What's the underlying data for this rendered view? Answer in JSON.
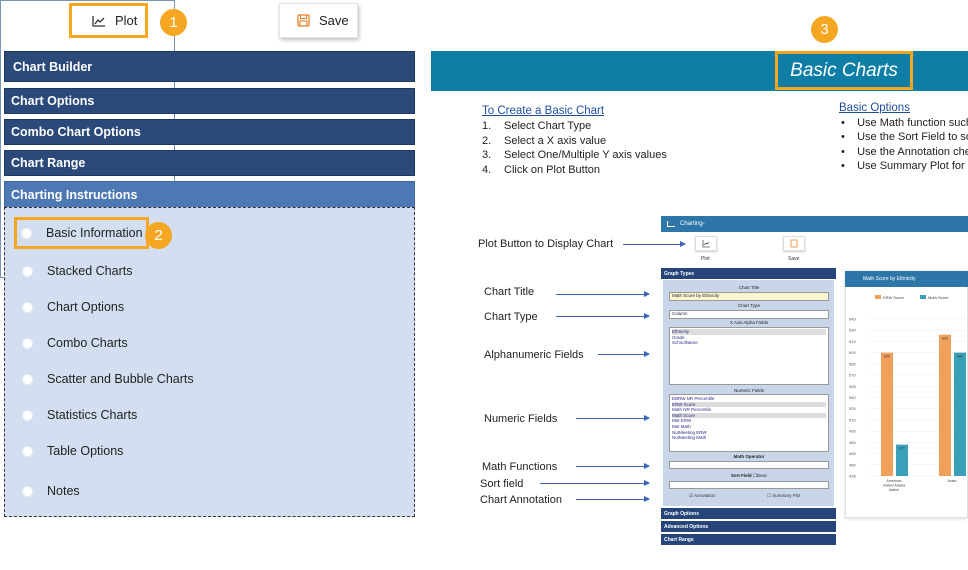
{
  "toolbar": {
    "plot_label": "Plot",
    "save_label": "Save",
    "plot_icon": "line-chart-icon",
    "save_icon": "floppy-disk-icon"
  },
  "callouts": [
    "1",
    "2",
    "3"
  ],
  "accordion": {
    "chart_builder": "Chart Builder",
    "chart_options": "Chart Options",
    "combo_chart_options": "Combo Chart Options",
    "chart_range": "Chart Range",
    "charting_instructions": "Charting Instructions",
    "items": [
      "Basic Information",
      "Stacked Charts",
      "Chart Options",
      "Combo Charts",
      "Scatter and Bubble Charts",
      "Statistics Charts",
      "Table Options",
      "Notes"
    ]
  },
  "right": {
    "banner_title": "Basic Charts",
    "create_title": "To Create a Basic Chart",
    "create_steps": [
      [
        "1.",
        "Select Chart Type"
      ],
      [
        "2.",
        "Select a X axis value"
      ],
      [
        "3.",
        "Select One/Multiple Y axis values"
      ],
      [
        "4.",
        "Click on Plot Button"
      ]
    ],
    "options_title": "Basic Options",
    "options_lines": [
      "Use Math function such",
      "Use the Sort Field to so",
      "Use the Annotation che",
      "Use Summary Plot for a"
    ],
    "annotations": {
      "plot_button": "Plot Button to Display Chart",
      "chart_title": "Chart Title",
      "chart_type": "Chart Type",
      "alphanumeric": "Alphanumeric Fields",
      "numeric": "Numeric Fields",
      "math_functions": "Math Functions",
      "sort_field": "Sort field",
      "chart_annotation": "Chart Annotation"
    }
  },
  "mini_app": {
    "header": "Charting-",
    "plot": "Plot",
    "save": "Save",
    "graph_types": "Graph Types",
    "chart_title_lbl": "Chart Title",
    "chart_title_val": "Math Score by Ethnicity",
    "chart_type_lbl": "Chart Type",
    "chart_type_val": "Column",
    "x_axis_lbl": "X Axis Alpha Fields",
    "x_axis_items": [
      "Ethnicity",
      "Grade",
      "SchoolName"
    ],
    "numeric_lbl": "Numeric Fields",
    "numeric_items": [
      "EBRW NR Percentile",
      "ERW Score",
      "Math NR Percentile",
      "Math Score",
      "Met ERW",
      "Met Math",
      "NotMeeting ERW",
      "NotMeeting Math"
    ],
    "math_operator": "Math Operator",
    "sort_field": "Sort Field",
    "desc": "Desc",
    "annotation": "Annotation",
    "summary_plot": "Summary Plot",
    "graph_options": "Graph Options",
    "advanced_options": "Advanced Options",
    "chart_range": "Chart Range"
  },
  "chart_data": {
    "type": "bar",
    "title": "Math Score by Ethnicity",
    "categories": [
      "American Indian/ Alaska Native",
      "Asian"
    ],
    "series": [
      {
        "name": "ERW Score",
        "values": [
          600,
          624
        ],
        "color": "#f0a05a"
      },
      {
        "name": "Math Score",
        "values": [
          477,
          600
        ],
        "color": "#3a9fb8"
      }
    ],
    "data_labels": [
      "600",
      "477",
      "624",
      "600"
    ],
    "yticks": [
      "645",
      "630",
      "615",
      "600",
      "585",
      "570",
      "555",
      "540",
      "525",
      "510",
      "495",
      "480",
      "465",
      "450",
      "435"
    ],
    "ylim": [
      435,
      645
    ]
  }
}
